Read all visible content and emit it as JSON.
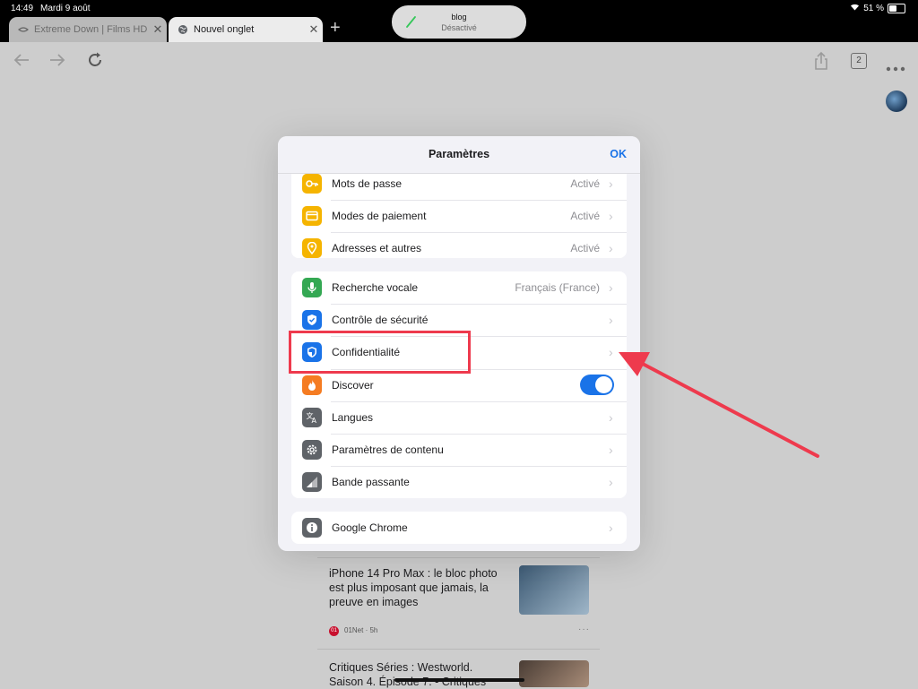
{
  "status_bar": {
    "time": "14:49",
    "date": "Mardi 9 août",
    "battery_pct": "51 %"
  },
  "tabs": [
    {
      "label": "Extreme Down | Films HD",
      "active": false
    },
    {
      "label": "Nouvel onglet",
      "active": true
    }
  ],
  "dynamic_island": {
    "title": "blog",
    "subtitle": "Désactivé"
  },
  "toolbar": {
    "tab_count": "2"
  },
  "feed": {
    "articles": [
      {
        "title": "iPhone 14 Pro Max : le bloc photo est plus imposant que jamais, la preuve en images",
        "source": "01Net · 5h"
      },
      {
        "title": "Critiques Séries : Westworld. Saison 4. Épisode 7. - Critiques"
      }
    ],
    "source_icon_text": "01"
  },
  "settings": {
    "title": "Paramètres",
    "ok_label": "OK",
    "group1": [
      {
        "label": "Mots de passe",
        "value": "Activé",
        "icon": "key-icon",
        "color": "#f5b400"
      },
      {
        "label": "Modes de paiement",
        "value": "Activé",
        "icon": "card-icon",
        "color": "#f5b400"
      },
      {
        "label": "Adresses et autres",
        "value": "Activé",
        "icon": "location-pin-icon",
        "color": "#f5b400"
      }
    ],
    "group2": [
      {
        "label": "Recherche vocale",
        "value": "Français (France)",
        "icon": "microphone-icon",
        "color": "#34a853"
      },
      {
        "label": "Contrôle de sécurité",
        "value": "",
        "icon": "shield-check-icon",
        "color": "#1a73e8"
      },
      {
        "label": "Confidentialité",
        "value": "",
        "icon": "shield-icon",
        "color": "#1a73e8"
      },
      {
        "label": "Discover",
        "value": "",
        "icon": "flame-icon",
        "color": "#f57c22",
        "toggle_on": true
      },
      {
        "label": "Langues",
        "value": "",
        "icon": "translate-icon",
        "color": "#5f6368"
      },
      {
        "label": "Paramètres de contenu",
        "value": "",
        "icon": "gear-icon",
        "color": "#5f6368"
      },
      {
        "label": "Bande passante",
        "value": "",
        "icon": "signal-icon",
        "color": "#5f6368"
      }
    ],
    "group3": [
      {
        "label": "Google Chrome",
        "value": "",
        "icon": "info-icon",
        "color": "#5f6368"
      }
    ]
  },
  "annotation": {
    "color": "#ee3a4d"
  }
}
